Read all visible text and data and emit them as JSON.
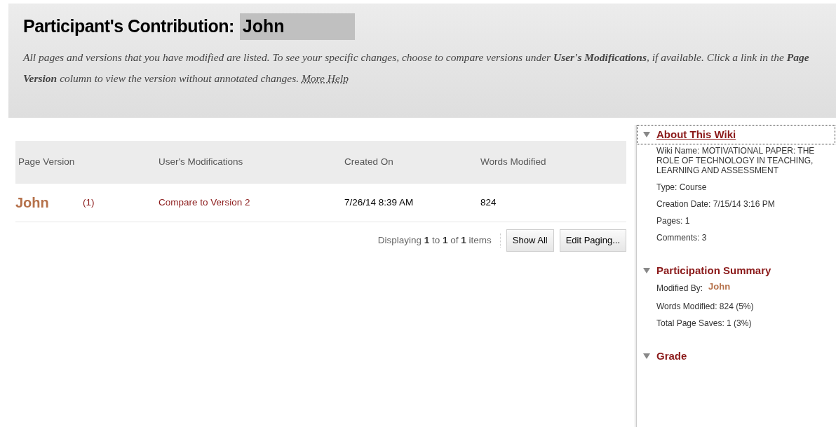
{
  "header": {
    "title": "Participant's Contribution:",
    "participant": "John",
    "description": "All pages and versions that you have modified are listed. To see your specific changes, choose to compare versions under **User's Modifications**, if available. Click a link in the **Page Version** column to view the version without annotated changes.",
    "help_link": "More Help"
  },
  "table": {
    "columns": [
      "Page Version",
      "User's Modifications",
      "Created On",
      "Words Modified"
    ],
    "rows": [
      {
        "page_version": "John",
        "version_count": "(1)",
        "modifications": "Compare to Version 2",
        "created_on": "7/26/14 8:39 AM",
        "words_modified": "824"
      }
    ]
  },
  "pagination": {
    "parts": [
      "Displaying ",
      "1",
      " to ",
      "1",
      " of ",
      "1",
      " items"
    ],
    "buttons": [
      "Show All",
      "Edit Paging..."
    ]
  },
  "sidebar": {
    "sections": [
      {
        "title": "About This Wiki",
        "expanded": true,
        "focused": true,
        "lines": [
          {
            "kind": "text",
            "text": "Wiki Name: MOTIVATIONAL PAPER: THE ROLE OF TECHNOLOGY IN TEACHING, LEARNING AND ASSESSMENT"
          },
          {
            "kind": "text",
            "text": "Type: Course"
          },
          {
            "kind": "text",
            "text": "Creation Date: 7/15/14 3:16 PM"
          },
          {
            "kind": "text",
            "text": "Pages: 1"
          },
          {
            "kind": "text",
            "text": "Comments: 3"
          }
        ]
      },
      {
        "title": "Participation Summary",
        "expanded": true,
        "focused": false,
        "lines": [
          {
            "kind": "user",
            "label": "Modified By:",
            "text": "John"
          },
          {
            "kind": "text",
            "text": "Words Modified: 824 (5%)"
          },
          {
            "kind": "text",
            "text": "Total Page Saves: 1 (3%)"
          }
        ]
      },
      {
        "title": "Grade",
        "expanded": true,
        "focused": false
      }
    ]
  }
}
